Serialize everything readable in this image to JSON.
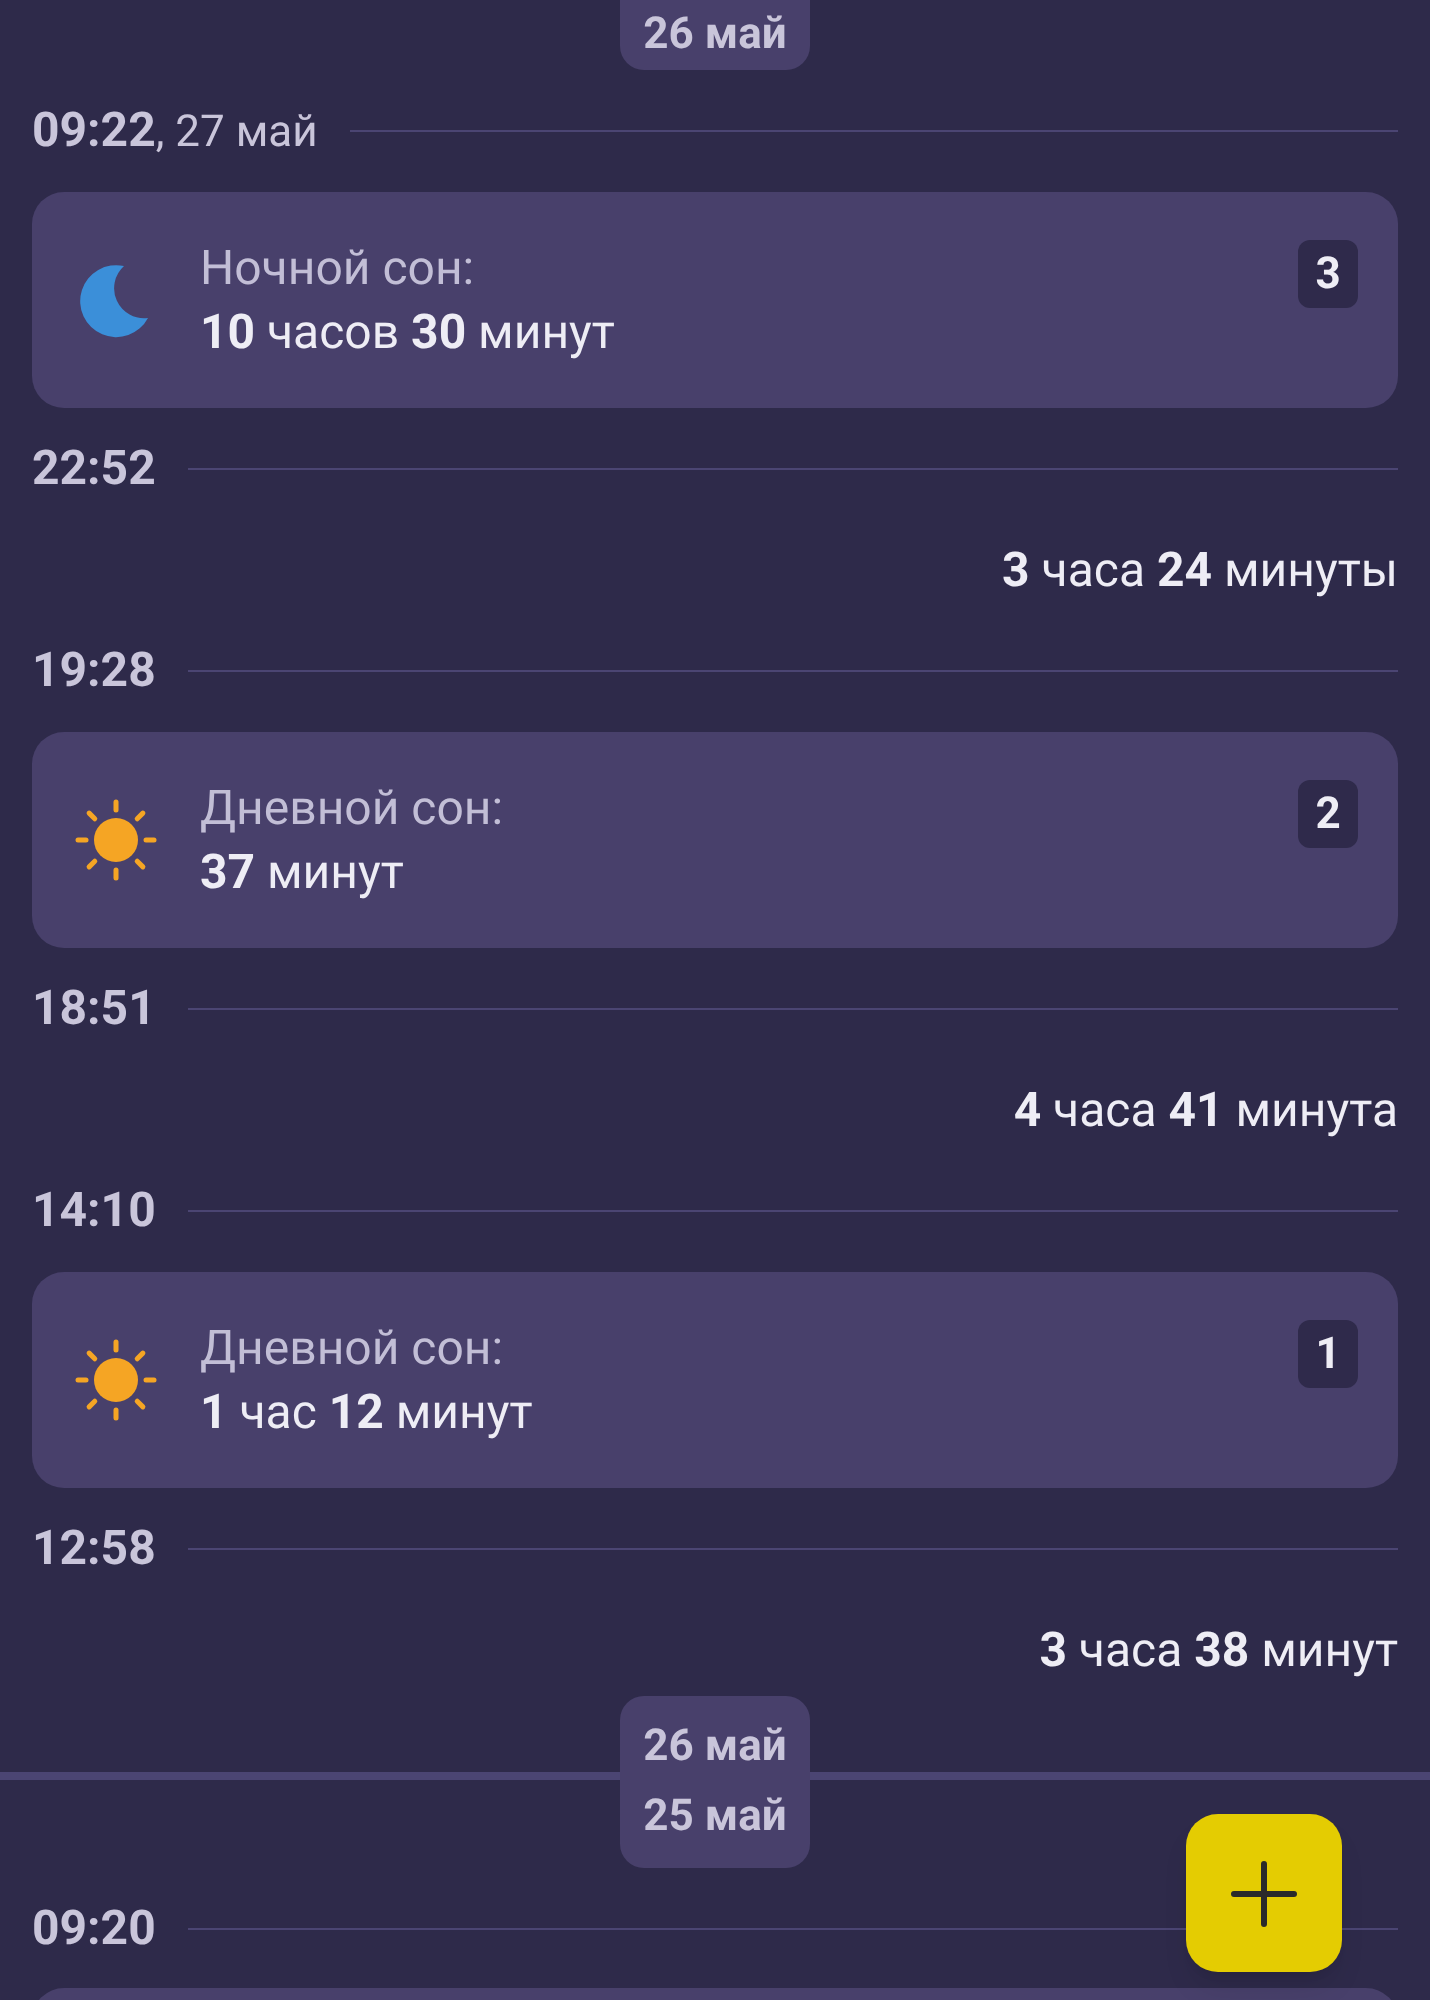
{
  "top_date_chip": "26 май",
  "timeline": [
    {
      "kind": "marker",
      "time": "09:22",
      "date": ", 27 май"
    },
    {
      "kind": "night_sleep",
      "label": "Ночной сон:",
      "duration": "**10** часов **30** минут",
      "number": "3"
    },
    {
      "kind": "marker",
      "time": "22:52"
    },
    {
      "kind": "gap",
      "duration": "**3** часа **24** минуты"
    },
    {
      "kind": "marker",
      "time": "19:28"
    },
    {
      "kind": "day_sleep",
      "label": "Дневной сон:",
      "duration": "**37** минут",
      "number": "2"
    },
    {
      "kind": "marker",
      "time": "18:51"
    },
    {
      "kind": "gap",
      "duration": "**4** часа **41** минута"
    },
    {
      "kind": "marker",
      "time": "14:10"
    },
    {
      "kind": "day_sleep",
      "label": "Дневной сон:",
      "duration": "**1** час **12** минут",
      "number": "1"
    },
    {
      "kind": "marker",
      "time": "12:58"
    },
    {
      "kind": "gap",
      "duration": "**3** часа **38** минут"
    },
    {
      "kind": "chips",
      "chips": [
        "26 май",
        "25 май"
      ]
    },
    {
      "kind": "marker",
      "time": "09:20"
    },
    {
      "kind": "card"
    }
  ]
}
